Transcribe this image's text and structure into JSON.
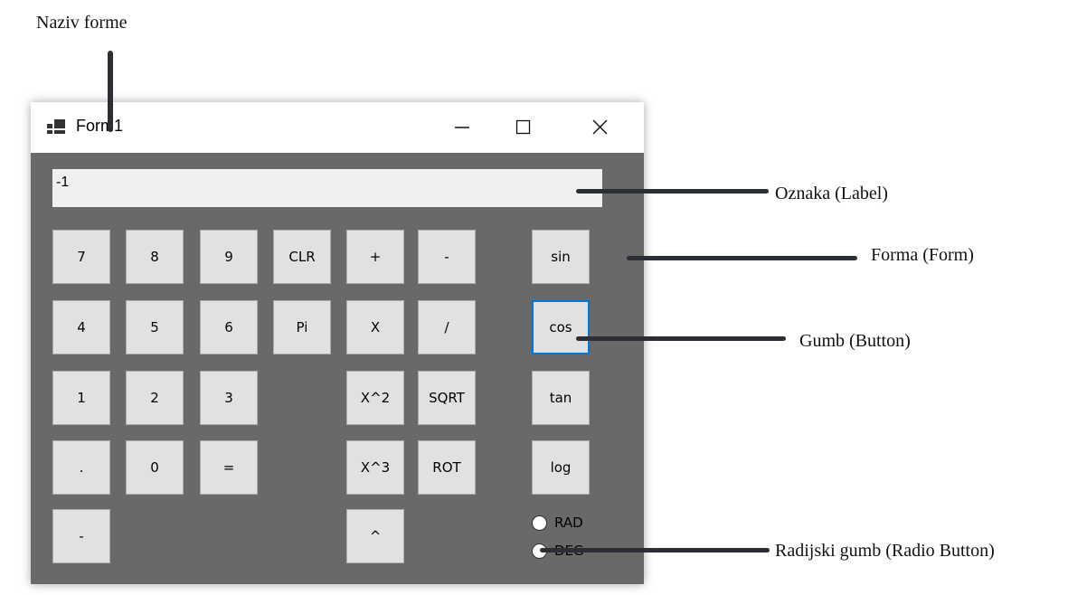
{
  "annotations": {
    "form_name": "Naziv forme",
    "label": "Oznaka (Label)",
    "form": "Forma (Form)",
    "button": "Gumb (Button)",
    "radio_button": "Radijski gumb (Radio Button)"
  },
  "window": {
    "title": "Form1",
    "icon": "app-form-icon",
    "controls": [
      "minimize-icon",
      "maximize-icon",
      "close-icon"
    ]
  },
  "display": {
    "value": "-1"
  },
  "buttons": {
    "b7": "7",
    "b8": "8",
    "b9": "9",
    "clr": "CLR",
    "plus": "+",
    "minus": "-",
    "sin": "sin",
    "b4": "4",
    "b5": "5",
    "b6": "6",
    "pi": "Pi",
    "mul": "X",
    "div": "/",
    "cos": "cos",
    "b1": "1",
    "b2": "2",
    "b3": "3",
    "sq": "X^2",
    "sqrt": "SQRT",
    "tan": "tan",
    "dot": ".",
    "b0": "0",
    "eq": "=",
    "cube": "X^3",
    "rot": "ROT",
    "log": "log",
    "neg": "-",
    "pow": "^"
  },
  "radios": {
    "rad": "RAD",
    "deg": "DEG"
  },
  "colors": {
    "window_bg": "#696969",
    "button_bg": "#e1e1e1",
    "focus": "#0078d7"
  }
}
